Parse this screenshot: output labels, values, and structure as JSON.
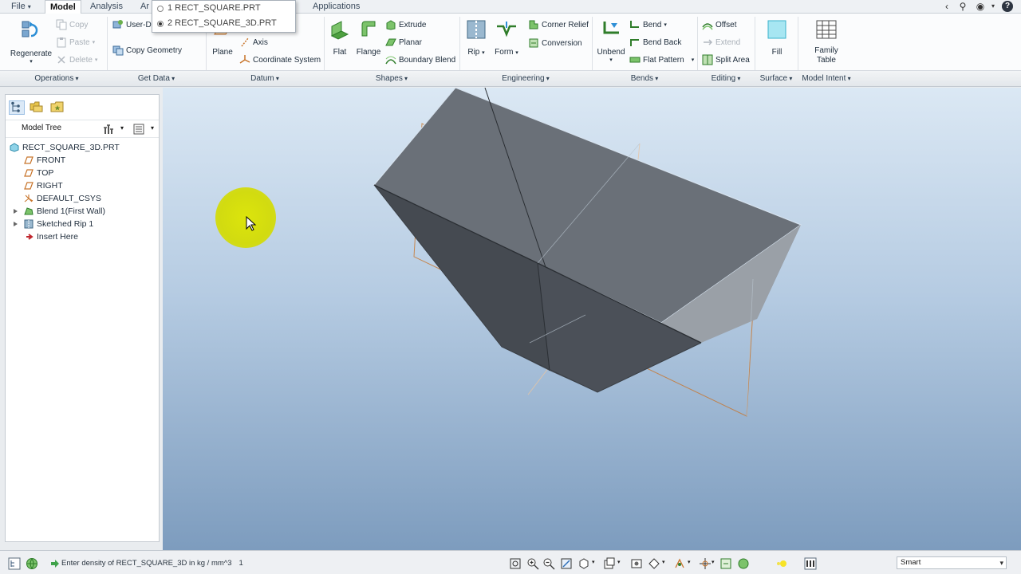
{
  "tabs": {
    "file": "File",
    "model": "Model",
    "analysis": "Analysis",
    "annotate_partial": "Ar",
    "applications": "Applications"
  },
  "window_list": {
    "items": [
      {
        "label": "1 RECT_SQUARE.PRT",
        "selected": false
      },
      {
        "label": "2 RECT_SQUARE_3D.PRT",
        "selected": true
      }
    ]
  },
  "ribbon": {
    "operations": {
      "regenerate": "Regenerate",
      "copy": "Copy",
      "paste": "Paste",
      "delete": "Delete",
      "group_label": "Operations"
    },
    "get_data": {
      "user_defined_partial": "User-D",
      "copy_geometry": "Copy Geometry",
      "group_label": "Get Data"
    },
    "datum": {
      "plane": "Plane",
      "axis": "Axis",
      "coordinate_system": "Coordinate System",
      "group_label": "Datum"
    },
    "shapes": {
      "flat": "Flat",
      "flange": "Flange",
      "extrude": "Extrude",
      "planar": "Planar",
      "boundary_blend": "Boundary Blend",
      "group_label": "Shapes"
    },
    "engineering": {
      "rip": "Rip",
      "form": "Form",
      "corner_relief": "Corner Relief",
      "conversion": "Conversion",
      "group_label": "Engineering"
    },
    "bends": {
      "unbend": "Unbend",
      "bend": "Bend",
      "bend_back": "Bend Back",
      "flat_pattern": "Flat Pattern",
      "group_label": "Bends"
    },
    "editing": {
      "offset": "Offset",
      "extend": "Extend",
      "split_area": "Split Area",
      "group_label": "Editing"
    },
    "surface": {
      "fill": "Fill",
      "group_label": "Surface"
    },
    "model_intent": {
      "family_table_line1": "Family",
      "family_table_line2": "Table",
      "group_label": "Model Intent"
    }
  },
  "model_tree": {
    "title": "Model Tree",
    "items": [
      {
        "label": "RECT_SQUARE_3D.PRT",
        "icon": "part-icon"
      },
      {
        "label": "FRONT",
        "icon": "datum-plane-icon"
      },
      {
        "label": "TOP",
        "icon": "datum-plane-icon"
      },
      {
        "label": "RIGHT",
        "icon": "datum-plane-icon"
      },
      {
        "label": "DEFAULT_CSYS",
        "icon": "csys-icon"
      },
      {
        "label": "Blend 1(First Wall)",
        "icon": "blend-icon"
      },
      {
        "label": "Sketched Rip 1",
        "icon": "rip-icon"
      },
      {
        "label": "Insert Here",
        "icon": "insert-arrow-icon"
      }
    ]
  },
  "status": {
    "message": "Enter density of RECT_SQUARE_3D in kg / mm^3",
    "value": "1",
    "selection_filter": "Smart"
  },
  "colors": {
    "accent_orange": "#c8742a",
    "part_face": "#5a5f66",
    "cursor_highlight": "#d4dc0f"
  }
}
